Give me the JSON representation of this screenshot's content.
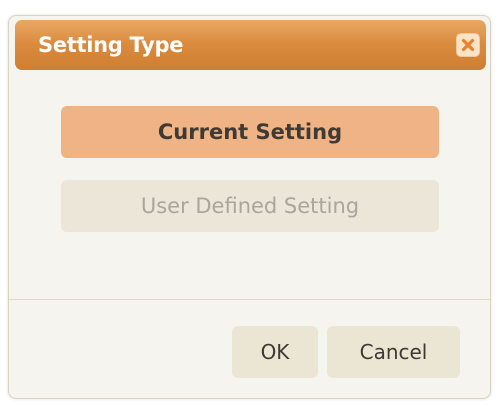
{
  "dialog": {
    "title": "Setting Type",
    "close_icon": "close-icon"
  },
  "options": {
    "current_label": "Current Setting",
    "user_defined_label": "User Defined Setting"
  },
  "footer": {
    "ok_label": "OK",
    "cancel_label": "Cancel"
  },
  "colors": {
    "titlebar": "#d98a3c",
    "selected_option": "#efb385",
    "disabled_option": "#ebe6d8",
    "close_icon": "#e9822a"
  }
}
